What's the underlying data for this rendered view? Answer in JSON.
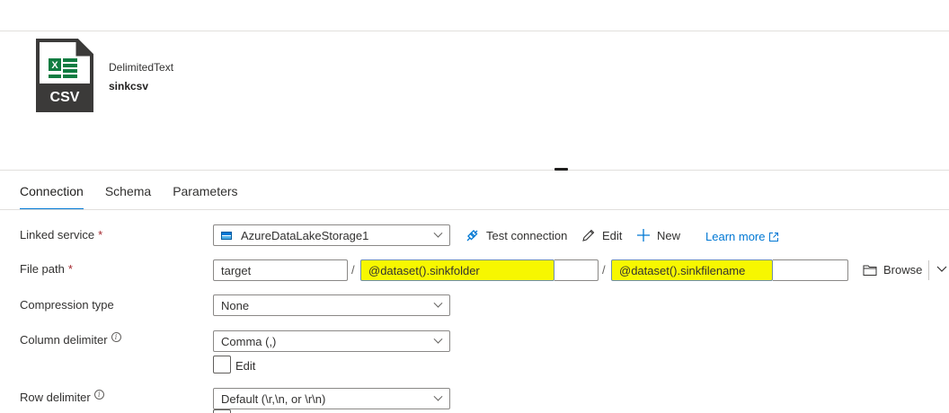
{
  "dataset": {
    "type": "DelimitedText",
    "name": "sinkcsv",
    "icon": "csv-file-icon",
    "icon_label": "CSV",
    "icon_accent": "#107c41"
  },
  "tabs": [
    {
      "label": "Connection",
      "active": true
    },
    {
      "label": "Schema",
      "active": false
    },
    {
      "label": "Parameters",
      "active": false
    }
  ],
  "form": {
    "linked_service": {
      "label": "Linked service",
      "required_mark": "*",
      "value": "AzureDataLakeStorage1",
      "icon": "storage-account-icon"
    },
    "actions": {
      "test_connection": "Test connection",
      "edit": "Edit",
      "new": "New",
      "learn_more": "Learn more"
    },
    "file_path": {
      "label": "File path",
      "required_mark": "*",
      "container": "target",
      "separator": "/",
      "directory": "@dataset().sinkfolder",
      "file": "@dataset().sinkfilename",
      "highlight_color": "#f7f700",
      "browse_label": "Browse"
    },
    "compression_type": {
      "label": "Compression type",
      "value": "None"
    },
    "column_delimiter": {
      "label": "Column delimiter",
      "value": "Comma (,)",
      "edit_label": "Edit"
    },
    "row_delimiter": {
      "label": "Row delimiter",
      "value": "Default (\\r,\\n, or \\r\\n)"
    },
    "info_glyph": "i"
  }
}
